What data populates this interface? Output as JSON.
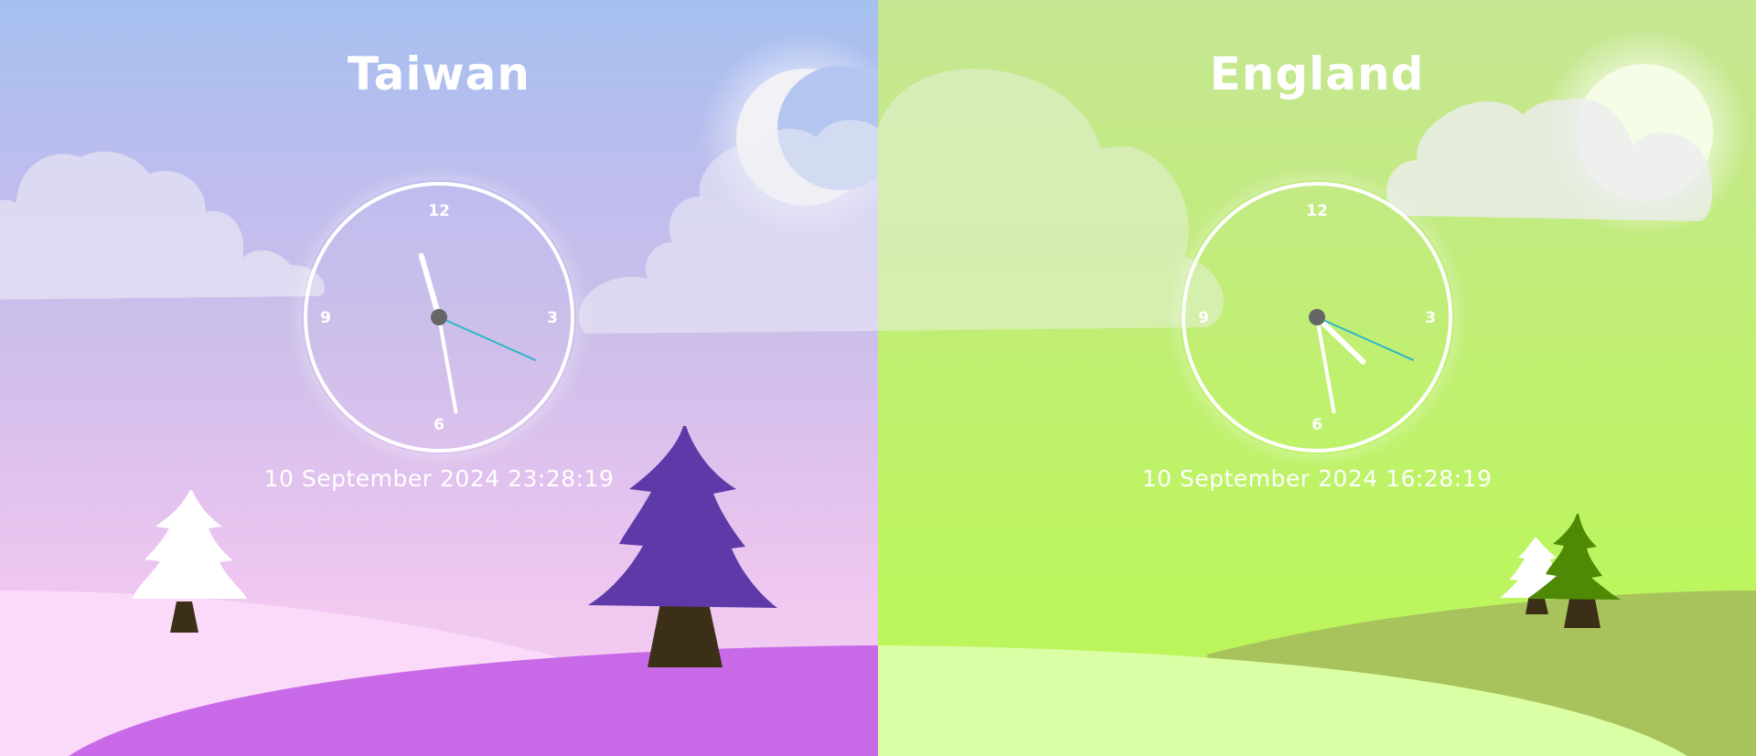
{
  "panels": [
    {
      "id": "taiwan",
      "city": "Taiwan",
      "datetime": "10 September 2024 23:28:19",
      "time": {
        "h": 23,
        "m": 28,
        "s": 19
      },
      "celestial": "moon",
      "theme": {
        "ground_front": "#c86ae8",
        "ground_back": "#fbd9f8",
        "tree_color": "#5e3aa8"
      }
    },
    {
      "id": "england",
      "city": "England",
      "datetime": "10 September 2024 16:28:19",
      "time": {
        "h": 16,
        "m": 28,
        "s": 19
      },
      "celestial": "sun",
      "theme": {
        "ground_front": "#dbffa4",
        "ground_back": "#a8c35c",
        "tree_color": "#4f8a06"
      }
    }
  ],
  "clock_numbers": [
    "12",
    "3",
    "6",
    "9"
  ],
  "colors": {
    "hand": "#ffffff",
    "second_hand": "#2fb6c8",
    "center_dot": "#666666"
  }
}
